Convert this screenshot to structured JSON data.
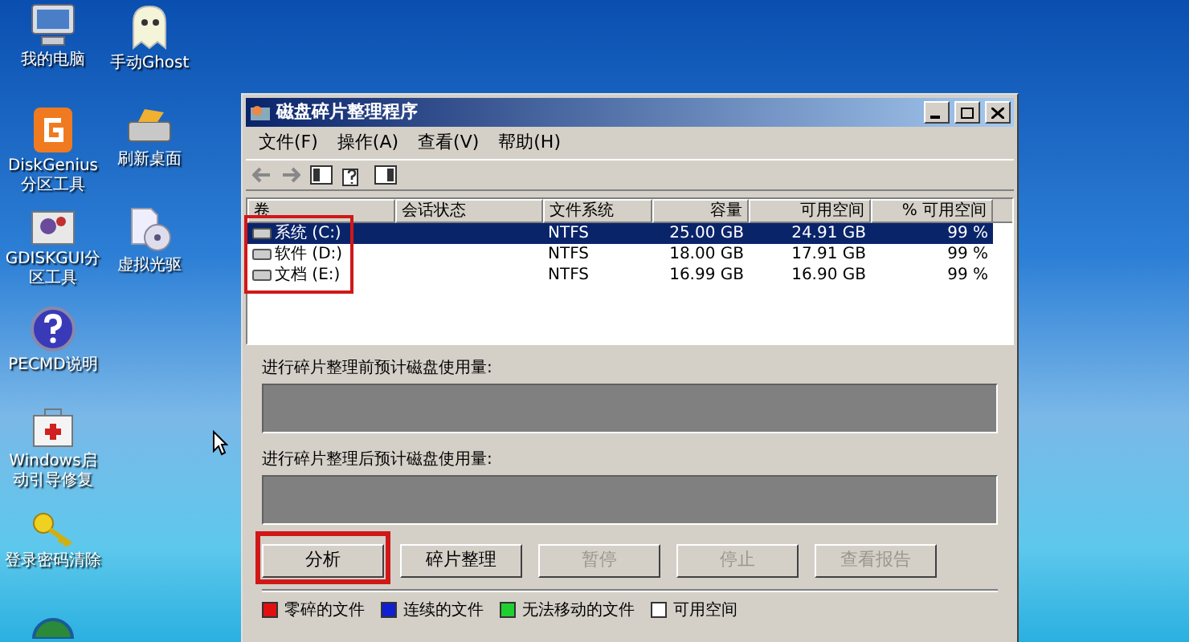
{
  "desktop_icons": [
    {
      "label": "我的电脑",
      "kind": "computer"
    },
    {
      "label": "手动Ghost",
      "kind": "ghost"
    },
    {
      "label": "DiskGenius分区工具",
      "kind": "diskgenius"
    },
    {
      "label": "刷新桌面",
      "kind": "refresh"
    },
    {
      "label": "GDISKGUI分区工具",
      "kind": "gdisk"
    },
    {
      "label": "虚拟光驱",
      "kind": "cdrom"
    },
    {
      "label": "PECMD说明",
      "kind": "help"
    },
    {
      "label": "Windows启动引导修复",
      "kind": "repair"
    },
    {
      "label": "登录密码清除",
      "kind": "key"
    },
    {
      "kind": "globe"
    }
  ],
  "window": {
    "title": "磁盘碎片整理程序",
    "menu": [
      "文件(F)",
      "操作(A)",
      "查看(V)",
      "帮助(H)"
    ],
    "volume_list": {
      "highlighted": true,
      "columns": [
        "卷",
        "会话状态",
        "文件系统",
        "容量",
        "可用空间",
        "% 可用空间"
      ],
      "rows": [
        {
          "volume": "系统 (C:)",
          "file_system": "NTFS",
          "capacity": "25.00 GB",
          "free": "24.91 GB",
          "percent_free": "99 %",
          "selected": true
        },
        {
          "volume": "软件 (D:)",
          "file_system": "NTFS",
          "capacity": "18.00 GB",
          "free": "17.91 GB",
          "percent_free": "99 %",
          "selected": false
        },
        {
          "volume": "文档 (E:)",
          "file_system": "NTFS",
          "capacity": "16.99 GB",
          "free": "16.90 GB",
          "percent_free": "99 %",
          "selected": false
        }
      ]
    },
    "usage_before_label": "进行碎片整理前预计磁盘使用量:",
    "usage_after_label": "进行碎片整理后预计磁盘使用量:",
    "buttons": [
      {
        "label": "分析",
        "disabled": false,
        "highlighted": true
      },
      {
        "label": "碎片整理",
        "disabled": false,
        "highlighted": false
      },
      {
        "label": "暂停",
        "disabled": true,
        "highlighted": false
      },
      {
        "label": "停止",
        "disabled": true,
        "highlighted": false
      },
      {
        "label": "查看报告",
        "disabled": true,
        "highlighted": false
      }
    ],
    "legend": [
      {
        "label": "零碎的文件",
        "color": "#e01010"
      },
      {
        "label": "连续的文件",
        "color": "#1020d0"
      },
      {
        "label": "无法移动的文件",
        "color": "#20d030"
      },
      {
        "label": "可用空间",
        "color": "#ffffff"
      }
    ]
  }
}
